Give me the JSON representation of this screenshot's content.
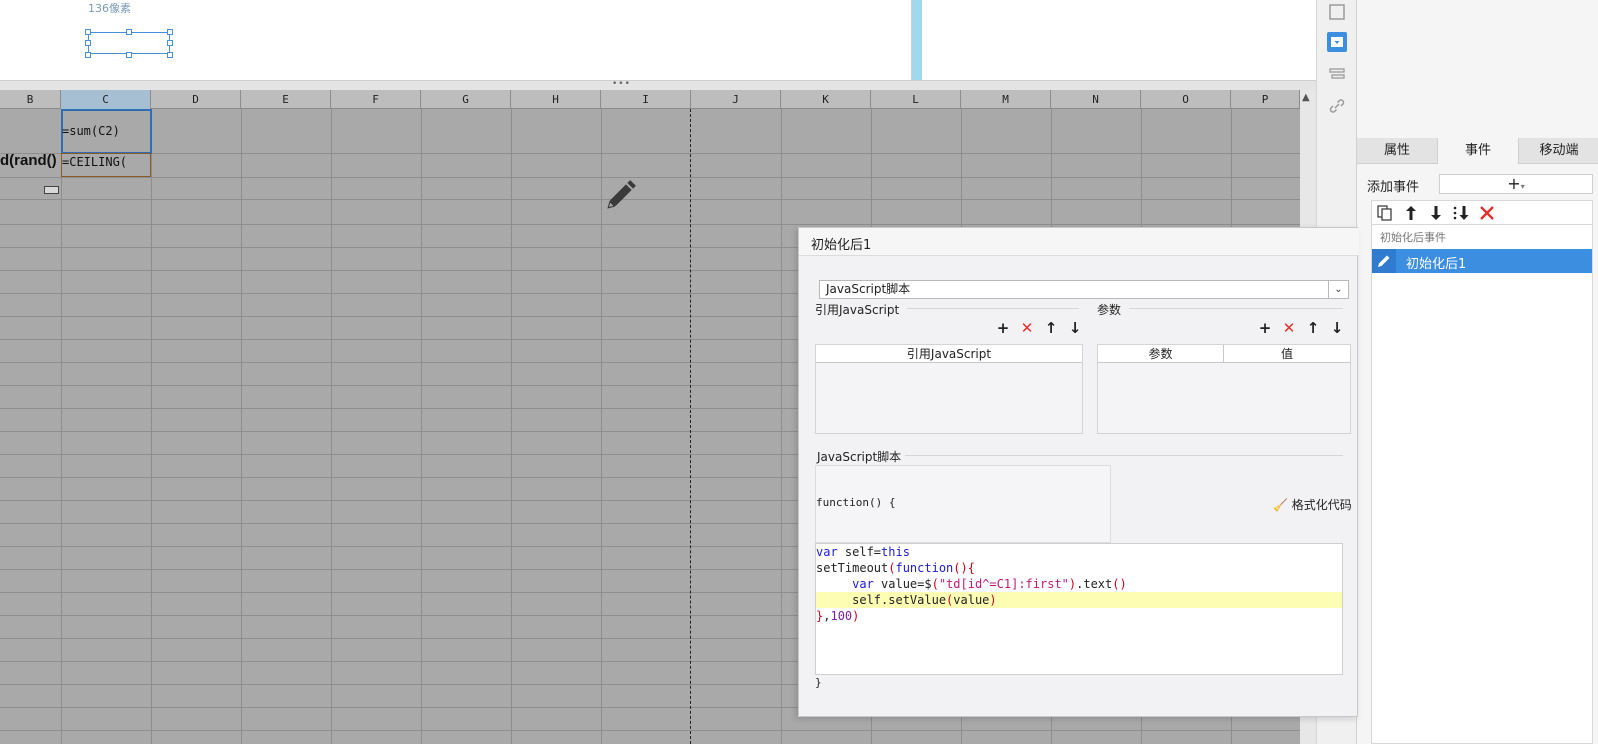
{
  "top_canvas": {
    "size_label": "136像素"
  },
  "sheet": {
    "columns": [
      "B",
      "C",
      "D",
      "E",
      "F",
      "G",
      "H",
      "I",
      "J",
      "K",
      "L",
      "M",
      "N",
      "O",
      "P"
    ],
    "active_column": "C",
    "cells": {
      "c1_formula": "=sum(C2)",
      "c2_formula": "=CEILING(",
      "b2_text": "d(rand()"
    }
  },
  "props_panel": {
    "tabs": [
      "属性",
      "事件",
      "移动端"
    ],
    "active_tab": "事件",
    "add_event_label": "添加事件",
    "add_event_button": "+",
    "event_group": "初始化后事件",
    "event_item": "初始化后1"
  },
  "dialog": {
    "title": "初始化后1",
    "script_type": "JavaScript脚本",
    "ref_section_label": "引用JavaScript",
    "ref_table_header": "引用JavaScript",
    "param_section_label": "参数",
    "param_headers": [
      "参数",
      "值"
    ],
    "script_section_label": "JavaScript脚本",
    "function_open": "function() {",
    "format_label": "格式化代码",
    "function_close": "}",
    "code_lines": [
      "var self=this",
      "setTimeout(function(){",
      "     var value=$(\"td[id^=C1]:first\").text()",
      "     self.setValue(value)",
      "},100)"
    ]
  },
  "colors": {
    "accent": "#3c8ee0",
    "sheet_bg": "#a9a9a9",
    "code_highlight": "#fdfdb3",
    "delete_red": "#e0312b"
  }
}
